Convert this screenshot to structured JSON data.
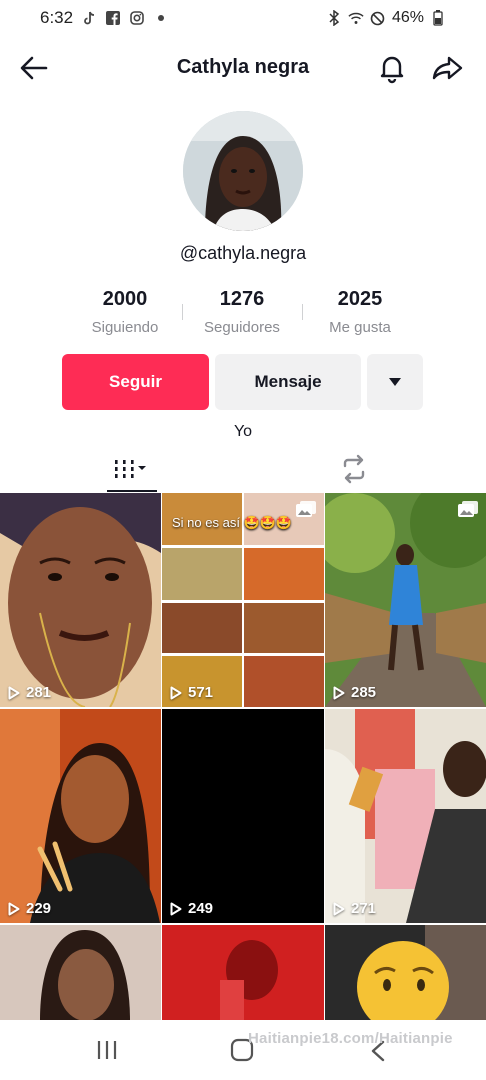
{
  "status_bar": {
    "time": "6:32",
    "battery": "46%"
  },
  "header": {
    "title": "Cathyla negra"
  },
  "profile": {
    "username": "@cathyla.negra",
    "bio": "Yo"
  },
  "stats": [
    {
      "value": "2000",
      "label": "Siguiendo"
    },
    {
      "value": "1276",
      "label": "Seguidores"
    },
    {
      "value": "2025",
      "label": "Me gusta"
    }
  ],
  "actions": {
    "follow": "Seguir",
    "message": "Mensaje"
  },
  "videos": [
    {
      "views": "281"
    },
    {
      "views": "571",
      "caption": "Si no es así 🤩🤩🤩"
    },
    {
      "views": "285"
    },
    {
      "views": "229"
    },
    {
      "views": "249"
    },
    {
      "views": "271"
    }
  ],
  "watermark": "Haitianpie18.com/Haitianpie"
}
